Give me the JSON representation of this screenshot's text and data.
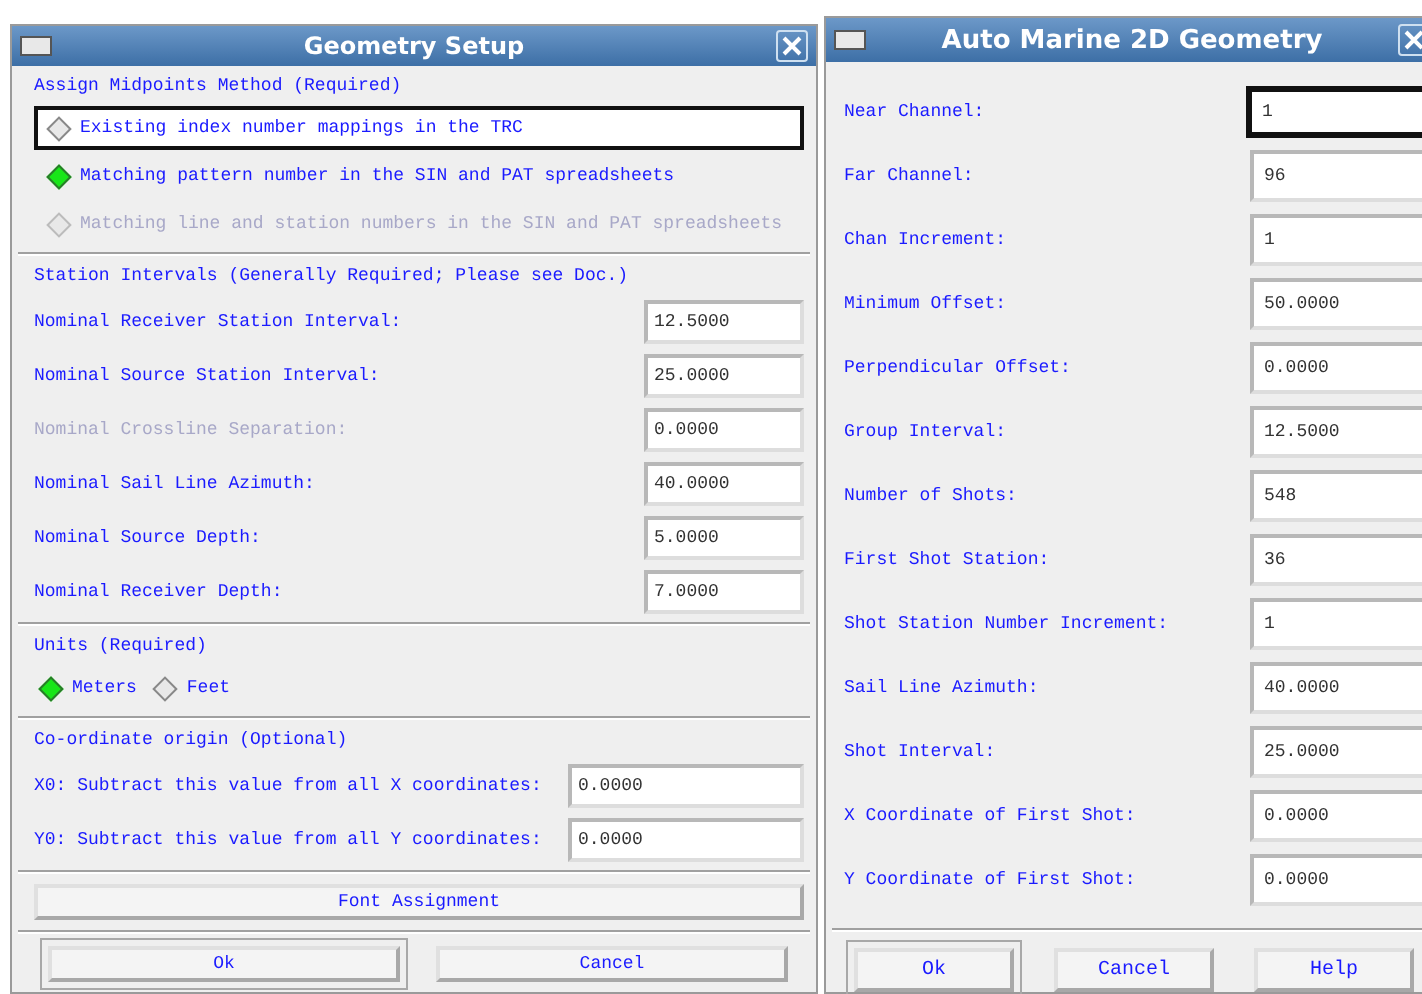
{
  "geometry_setup": {
    "title": "Geometry Setup",
    "sections": [
      {
        "kind": "radios",
        "heading": "Assign Midpoints Method (Required)",
        "options": [
          {
            "label": "Existing index number mappings in the TRC",
            "selected": false,
            "disabled": false,
            "focused": true
          },
          {
            "label": "Matching pattern number in the SIN and PAT spreadsheets",
            "selected": true,
            "disabled": false,
            "focused": false
          },
          {
            "label": "Matching line and station numbers in the SIN and PAT spreadsheets",
            "selected": false,
            "disabled": true,
            "focused": false
          }
        ]
      },
      {
        "kind": "fields",
        "heading": "Station Intervals (Generally Required; Please see Doc.)",
        "fields": [
          {
            "label": "Nominal Receiver Station Interval:",
            "value": "12.5000",
            "disabled": false
          },
          {
            "label": "Nominal Source Station Interval:",
            "value": "25.0000",
            "disabled": false
          },
          {
            "label": "Nominal Crossline Separation:",
            "value": "0.0000",
            "disabled": true
          },
          {
            "label": "Nominal Sail Line Azimuth:",
            "value": "40.0000",
            "disabled": false
          },
          {
            "label": "Nominal Source Depth:",
            "value": "5.0000",
            "disabled": false
          },
          {
            "label": "Nominal Receiver Depth:",
            "value": "7.0000",
            "disabled": false
          }
        ]
      },
      {
        "kind": "inline_radios",
        "heading": "Units (Required)",
        "options": [
          {
            "label": "Meters",
            "selected": true,
            "disabled": false,
            "focused": false
          },
          {
            "label": "Feet",
            "selected": false,
            "disabled": false,
            "focused": false
          }
        ]
      },
      {
        "kind": "wide_fields",
        "heading": "Co-ordinate origin (Optional)",
        "fields": [
          {
            "label": "X0: Subtract this value from all X coordinates:",
            "value": "0.0000",
            "disabled": false
          },
          {
            "label": "Y0: Subtract this value from all Y coordinates:",
            "value": "0.0000",
            "disabled": false
          }
        ]
      }
    ],
    "font_button": "Font Assignment",
    "buttons": [
      {
        "label": "Ok",
        "default": true
      },
      {
        "label": "Cancel",
        "default": false
      }
    ]
  },
  "auto_marine": {
    "title": "Auto Marine 2D Geometry",
    "fields": [
      {
        "label": "Near Channel:",
        "value": "1",
        "focused": true
      },
      {
        "label": "Far Channel:",
        "value": "96",
        "focused": false
      },
      {
        "label": "Chan Increment:",
        "value": "1",
        "focused": false
      },
      {
        "label": "Minimum Offset:",
        "value": "50.0000",
        "focused": false
      },
      {
        "label": "Perpendicular Offset:",
        "value": "0.0000",
        "focused": false
      },
      {
        "label": "Group Interval:",
        "value": "12.5000",
        "focused": false
      },
      {
        "label": "Number of Shots:",
        "value": "548",
        "focused": false
      },
      {
        "label": "First Shot Station:",
        "value": "36",
        "focused": false
      },
      {
        "label": "Shot Station Number Increment:",
        "value": "1",
        "focused": false
      },
      {
        "label": "Sail Line Azimuth:",
        "value": "40.0000",
        "focused": false
      },
      {
        "label": "Shot Interval:",
        "value": "25.0000",
        "focused": false
      },
      {
        "label": "X Coordinate of First Shot:",
        "value": "0.0000",
        "focused": false
      },
      {
        "label": "Y Coordinate of First Shot:",
        "value": "0.0000",
        "focused": false
      }
    ],
    "buttons": [
      {
        "label": "Ok",
        "default": true
      },
      {
        "label": "Cancel",
        "default": false
      },
      {
        "label": "Help",
        "default": false
      }
    ]
  }
}
